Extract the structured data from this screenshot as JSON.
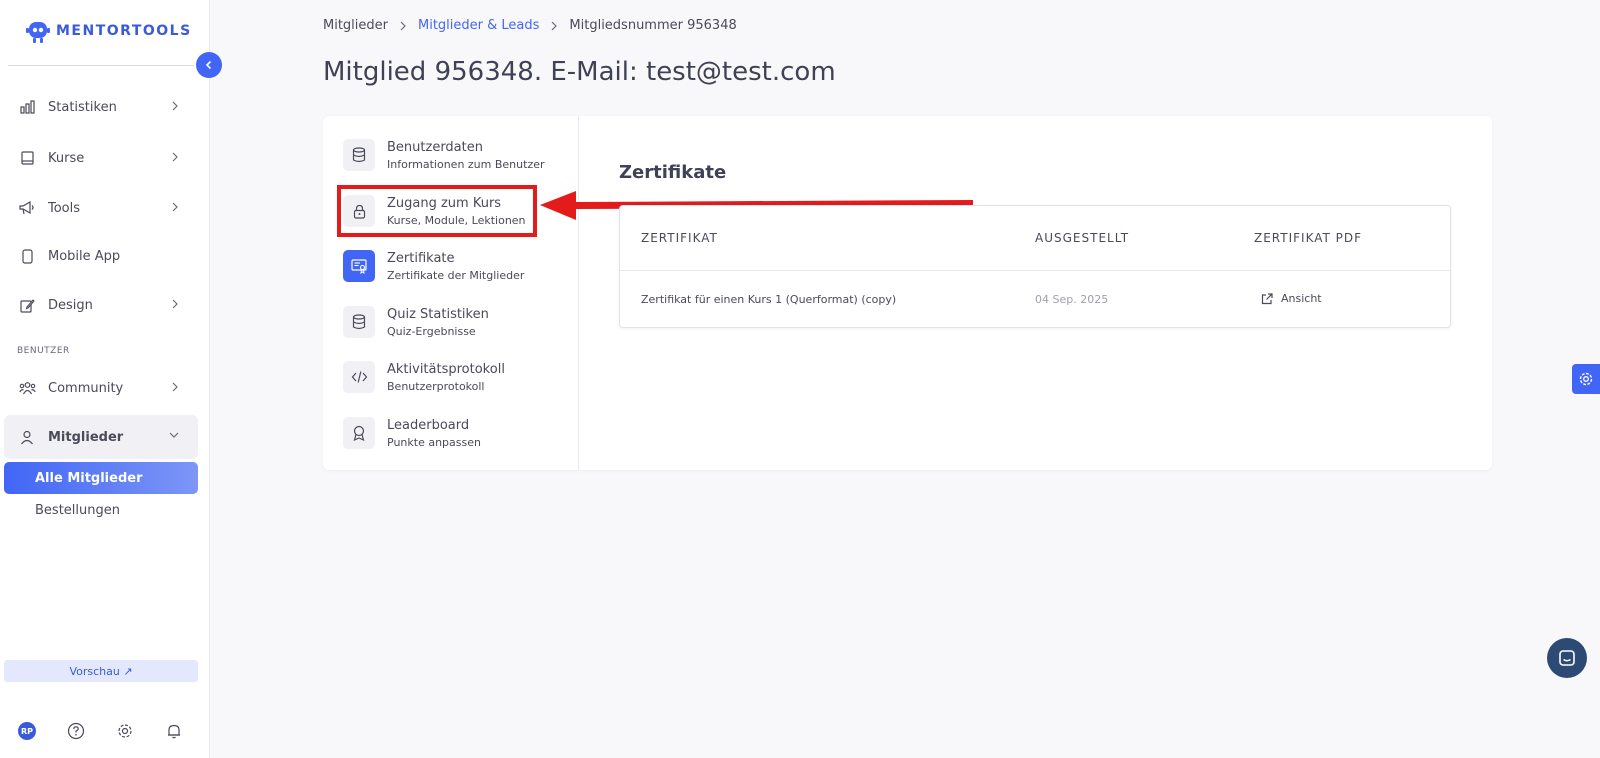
{
  "brand": {
    "name": "MENTORTOOLS",
    "accent": "#4166f5"
  },
  "sidebar": {
    "items": [
      {
        "label": "Statistiken",
        "icon": "bar-chart-icon"
      },
      {
        "label": "Kurse",
        "icon": "book-icon"
      },
      {
        "label": "Tools",
        "icon": "megaphone-icon"
      },
      {
        "label": "Mobile App",
        "icon": "phone-icon"
      },
      {
        "label": "Design",
        "icon": "edit-icon"
      }
    ],
    "section_label": "BENUTZER",
    "community": "Community",
    "mitglieder": "Mitglieder",
    "sub_items": [
      "Alle Mitglieder",
      "Bestellungen"
    ],
    "preview": "Vorschau ↗",
    "avatar_initials": "RP"
  },
  "breadcrumb": {
    "first": "Mitglieder",
    "second": "Mitglieder & Leads",
    "third": "Mitgliedsnummer 956348"
  },
  "page_title": "Mitglied 956348. E-Mail: test@test.com",
  "menu": [
    {
      "title": "Benutzerdaten",
      "sub": "Informationen zum Benutzer",
      "icon": "database-icon"
    },
    {
      "title": "Zugang zum Kurs",
      "sub": "Kurse, Module, Lektionen",
      "icon": "lock-icon"
    },
    {
      "title": "Zertifikate",
      "sub": "Zertifikate der Mitglieder",
      "icon": "certificate-icon"
    },
    {
      "title": "Quiz Statistiken",
      "sub": "Quiz-Ergebnisse",
      "icon": "database-icon"
    },
    {
      "title": "Aktivitätsprotokoll",
      "sub": "Benutzerprotokoll",
      "icon": "code-icon"
    },
    {
      "title": "Leaderboard",
      "sub": "Punkte anpassen",
      "icon": "award-icon"
    }
  ],
  "certificates": {
    "title": "Zertifikate",
    "columns": [
      "ZERTIFIKAT",
      "AUSGESTELLT",
      "ZERTIFIKAT PDF"
    ],
    "rows": [
      {
        "name": "Zertifikat für einen Kurs 1 (Querformat) (copy)",
        "date": "04 Sep. 2025",
        "action": "Ansicht"
      }
    ]
  }
}
